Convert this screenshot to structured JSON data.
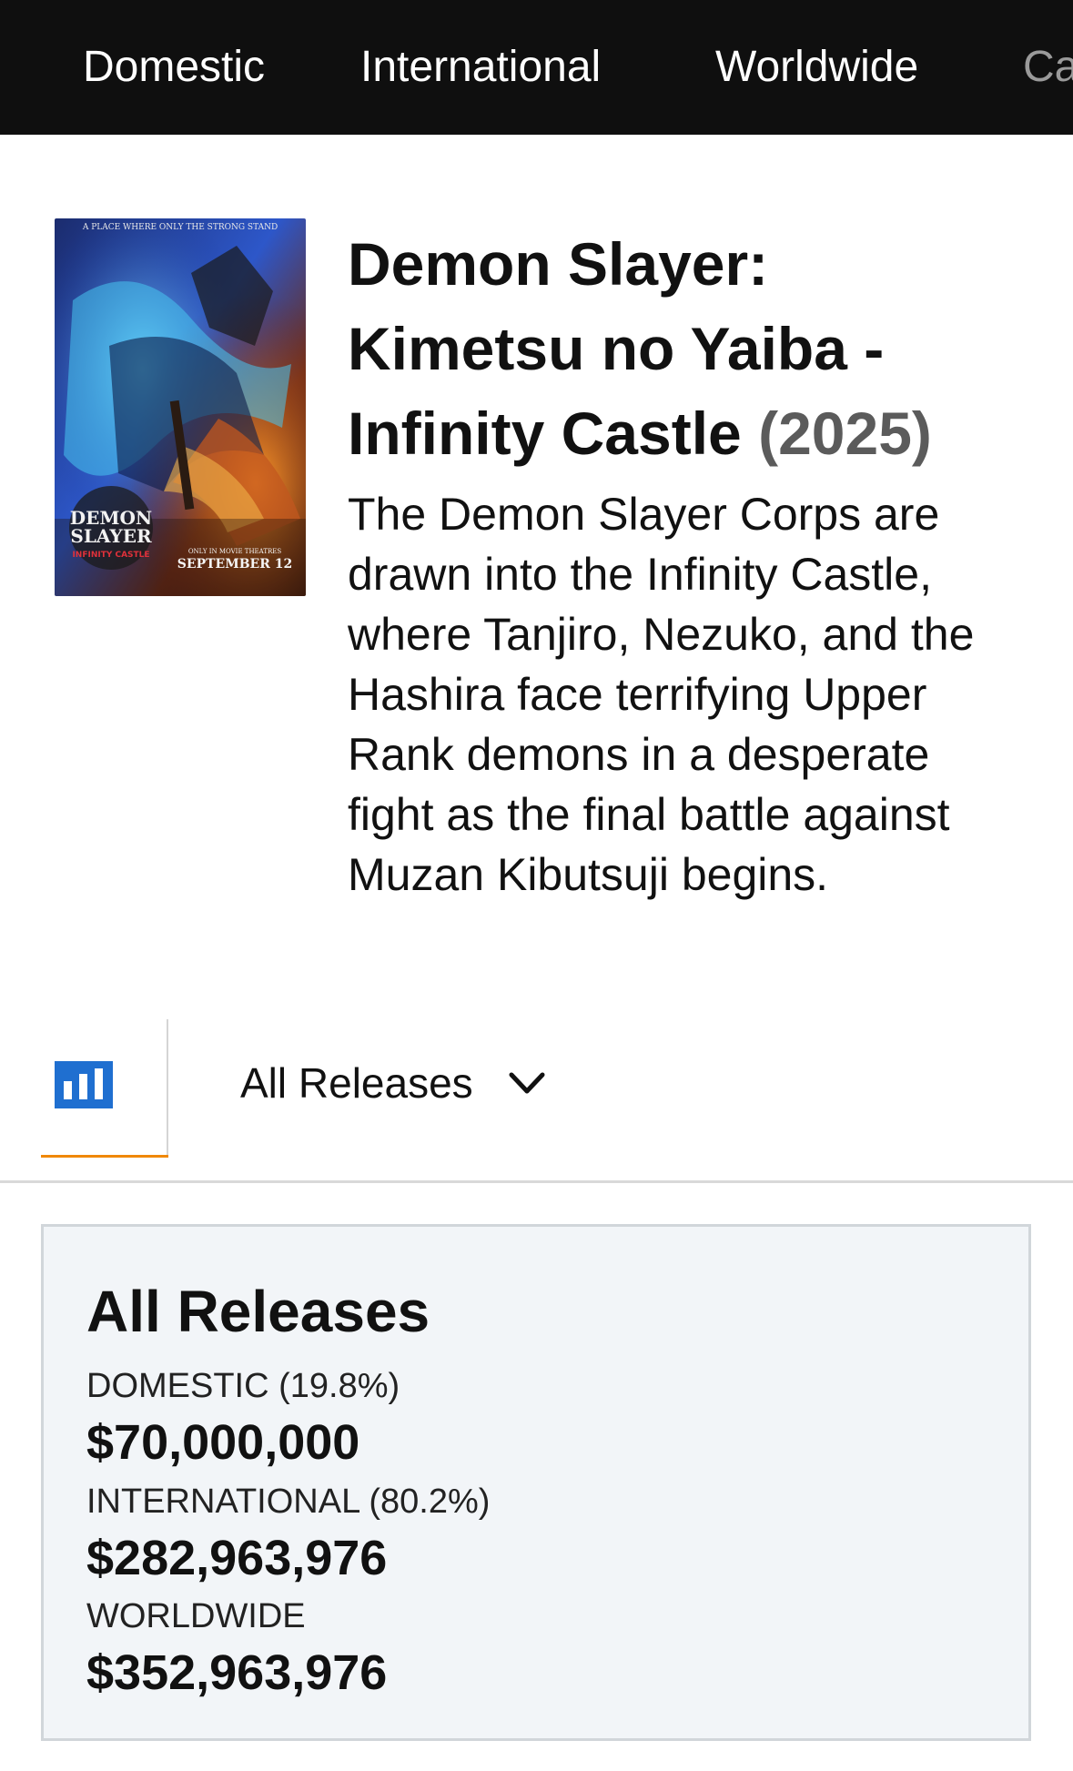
{
  "nav": {
    "tabs": [
      {
        "label": "Domestic"
      },
      {
        "label": "International"
      },
      {
        "label": "Worldwide"
      },
      {
        "label": "Ca"
      }
    ]
  },
  "movie": {
    "title": "Demon Slayer: Kimetsu no Yaiba - Infinity Castle",
    "year": "(2025)",
    "description": "The Demon Slayer Corps are drawn into the Infinity Castle, where Tanjiro, Nezuko, and the Hashira face terrifying Upper Rank demons in a desperate fight as the final battle against Muzan Kibutsuji begins.",
    "poster": {
      "tagline": "A PLACE WHERE ONLY THE STRONG STAND",
      "logo_line1": "DEMON",
      "logo_line2": "SLAYER",
      "logo_line3": "INFINITY CASTLE",
      "release_line1": "ONLY IN MOVIE THEATRES",
      "release_line2": "SEPTEMBER 12"
    }
  },
  "toolbar": {
    "chart_icon": "bar-chart-icon",
    "release_select": "All Releases",
    "chevron_icon": "chevron-down-icon"
  },
  "summary": {
    "heading": "All Releases",
    "rows": [
      {
        "label": "DOMESTIC (19.8%)",
        "amount": "$70,000,000"
      },
      {
        "label": "INTERNATIONAL (80.2%)",
        "amount": "$282,963,976"
      },
      {
        "label": "WORLDWIDE",
        "amount": "$352,963,976"
      }
    ]
  },
  "colors": {
    "nav_bg": "#0f0f0f",
    "accent_underline": "#f08804",
    "chart_icon_blue": "#1f6fd0",
    "card_bg": "#f2f5f8",
    "year_gray": "#5b5b5b"
  }
}
